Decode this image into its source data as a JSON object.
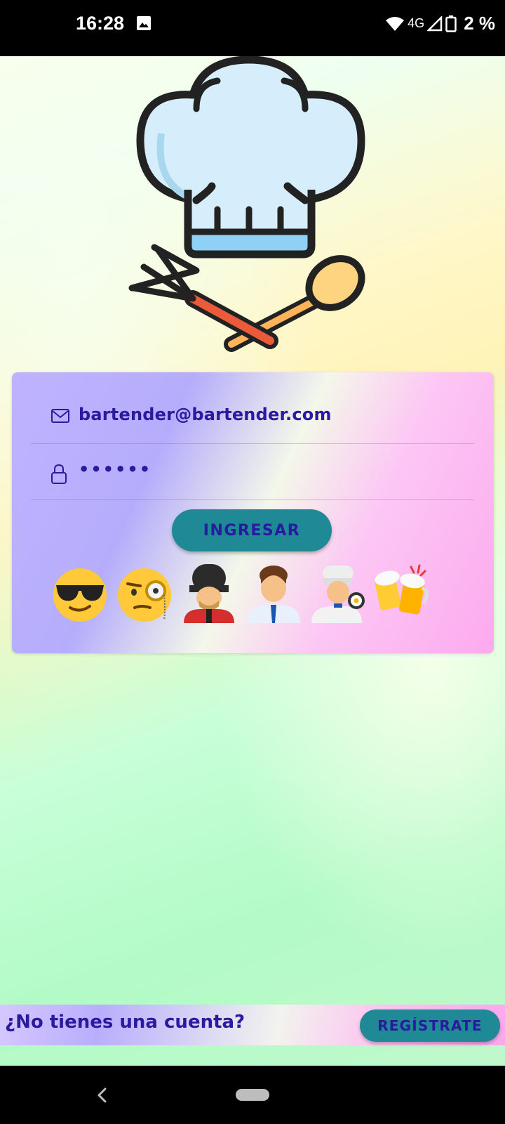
{
  "status_bar": {
    "time": "16:28",
    "network": "4G",
    "battery": "2 %",
    "icons": [
      "image-icon",
      "wifi-icon",
      "signal-icon",
      "battery-icon"
    ]
  },
  "login": {
    "email_value": "bartender@bartender.com",
    "password_value": "••••••",
    "login_button": "INGRESAR",
    "emojis": [
      "😎",
      "🧐",
      "💂",
      "👨‍💼",
      "🧑‍🍳",
      "🍻"
    ]
  },
  "footer": {
    "prompt": "¿No tienes una cuenta?",
    "register_button": "REGÍSTRATE"
  },
  "colors": {
    "accent": "#1f8a95",
    "text": "#2a1aa0"
  }
}
